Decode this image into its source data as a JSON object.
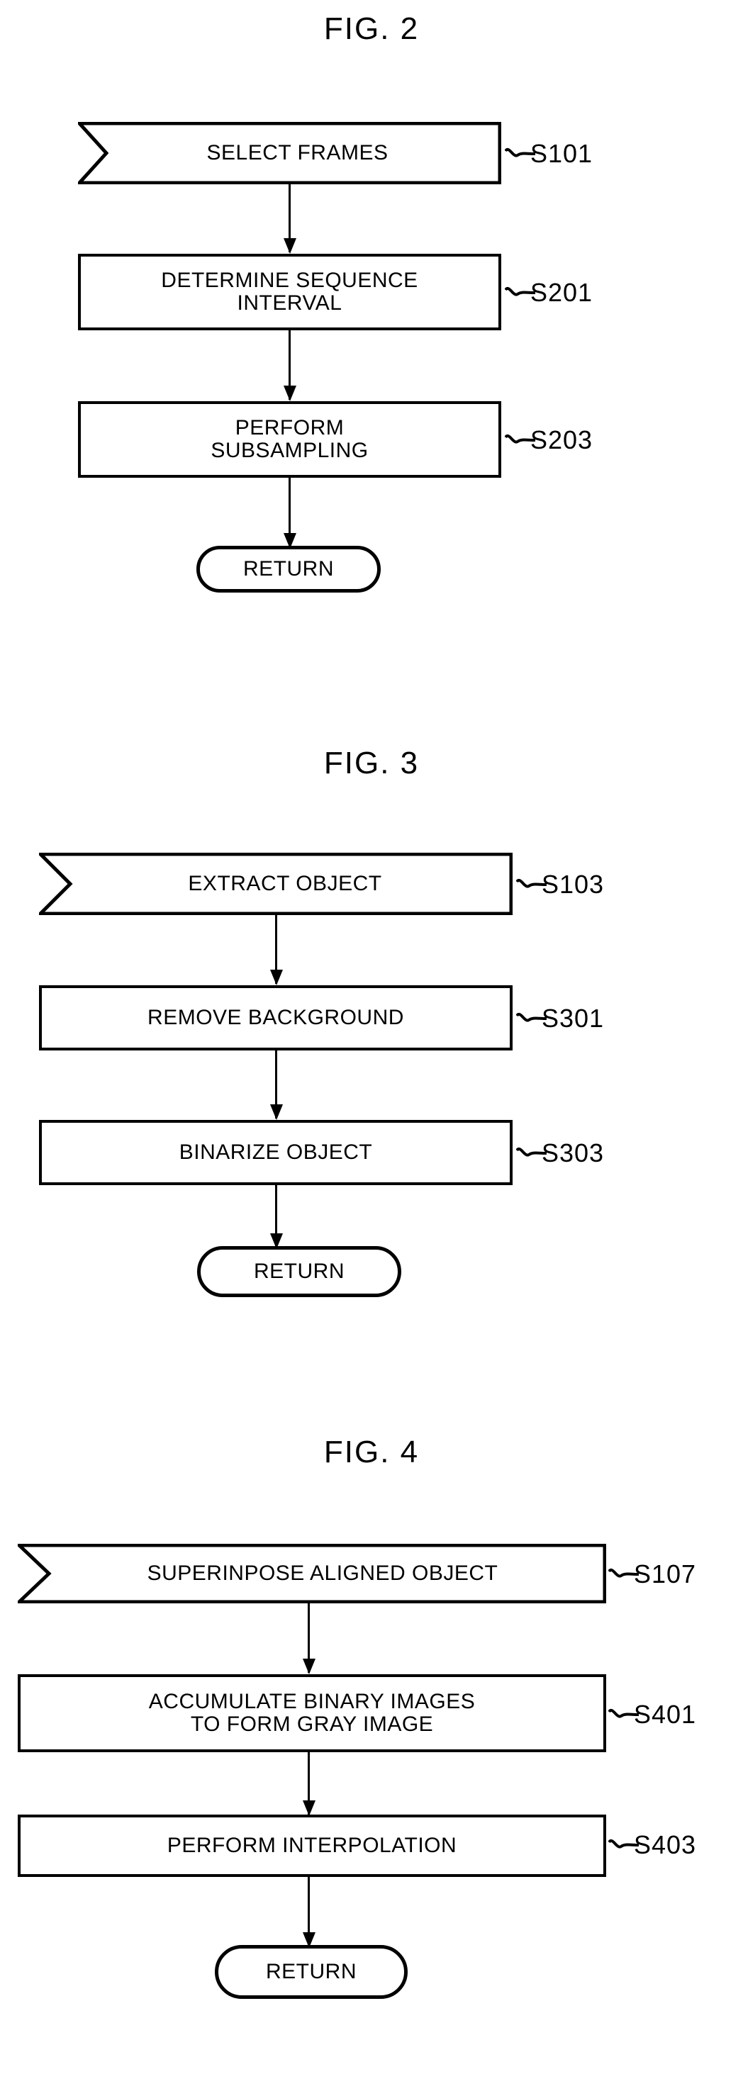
{
  "document": {
    "type": "patent-flowchart-sheet",
    "background_color": "#ffffff",
    "ink_color": "#000000"
  },
  "figures": [
    {
      "id": "fig-2",
      "title": "FIG. 2",
      "nodes": [
        {
          "id": "s101",
          "shape": "chevron",
          "label": "SELECT FRAMES",
          "ref": "S101"
        },
        {
          "id": "s201",
          "shape": "rect",
          "label": "DETERMINE SEQUENCE\nINTERVAL",
          "ref": "S201"
        },
        {
          "id": "s203",
          "shape": "rect",
          "label": "PERFORM\nSUBSAMPLING",
          "ref": "S203"
        },
        {
          "id": "return2",
          "shape": "oval",
          "label": "RETURN",
          "ref": ""
        }
      ]
    },
    {
      "id": "fig-3",
      "title": "FIG. 3",
      "nodes": [
        {
          "id": "s103",
          "shape": "chevron",
          "label": "EXTRACT OBJECT",
          "ref": "S103"
        },
        {
          "id": "s301",
          "shape": "rect",
          "label": "REMOVE BACKGROUND",
          "ref": "S301"
        },
        {
          "id": "s303",
          "shape": "rect",
          "label": "BINARIZE OBJECT",
          "ref": "S303"
        },
        {
          "id": "return3",
          "shape": "oval",
          "label": "RETURN",
          "ref": ""
        }
      ]
    },
    {
      "id": "fig-4",
      "title": "FIG. 4",
      "nodes": [
        {
          "id": "s107",
          "shape": "chevron",
          "label": "SUPERINPOSE ALIGNED OBJECT",
          "ref": "S107"
        },
        {
          "id": "s401",
          "shape": "rect",
          "label": "ACCUMULATE BINARY IMAGES\nTO FORM GRAY IMAGE",
          "ref": "S401"
        },
        {
          "id": "s403",
          "shape": "rect",
          "label": "PERFORM INTERPOLATION",
          "ref": "S403"
        },
        {
          "id": "return4",
          "shape": "oval",
          "label": "RETURN",
          "ref": ""
        }
      ]
    }
  ]
}
